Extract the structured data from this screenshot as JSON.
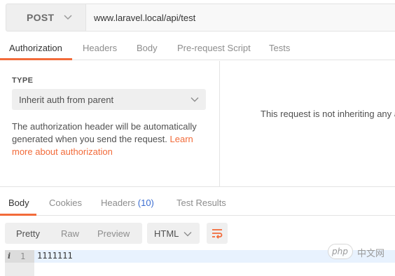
{
  "request": {
    "method": "POST",
    "url": "www.laravel.local/api/test"
  },
  "request_tabs": {
    "active": "Authorization",
    "labels": [
      "Authorization",
      "Headers",
      "Body",
      "Pre-request Script",
      "Tests"
    ]
  },
  "auth": {
    "type_label": "TYPE",
    "selected_type": "Inherit auth from parent",
    "description": "The authorization header will be automatically generated when you send the request. ",
    "link_text": "Learn more about authorization",
    "right_message": "This request is not inheriting any a"
  },
  "response_tabs": {
    "active": "Body",
    "labels": [
      "Body",
      "Cookies",
      "Headers",
      "Test Results"
    ],
    "headers_count": "(10)"
  },
  "toolbar": {
    "formats": [
      "Pretty",
      "Raw",
      "Preview"
    ],
    "active_format": "Pretty",
    "language": "HTML"
  },
  "code": {
    "line_number": "1",
    "info_glyph": "i",
    "line_text": "1111111"
  },
  "watermark": {
    "badge": "php",
    "text": "中文网"
  },
  "colors": {
    "accent": "#f26b3a",
    "link": "#f26b3a",
    "count": "#3b6dd1",
    "highlight": "#e8f2fe"
  },
  "icons": {
    "method_dropdown": "chevron-down-icon",
    "auth_dropdown": "chevron-down-icon",
    "language_dropdown": "chevron-down-icon",
    "wrap": "wrap-lines-icon",
    "gutter_info": "info-icon"
  }
}
